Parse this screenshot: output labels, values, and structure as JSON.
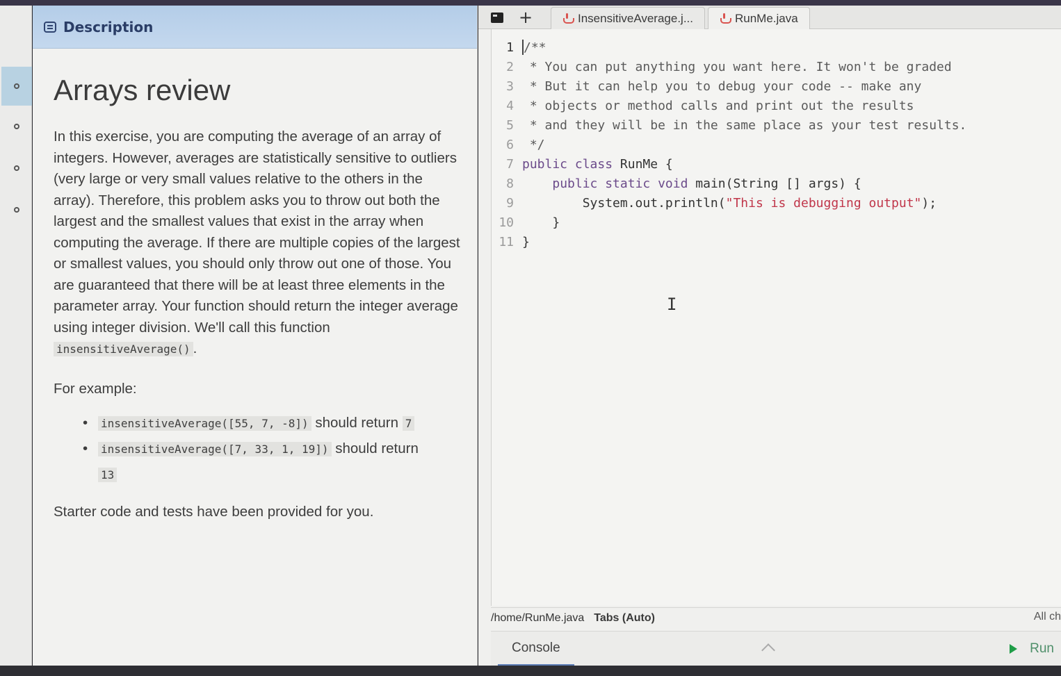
{
  "description_panel": {
    "header": "Description",
    "title": "Arrays review",
    "paragraph_parts": [
      "In this exercise, you are computing the average of an array of integers. However, averages are statistically sensitive to outliers (very large or very small values relative to the others in the array). Therefore, this problem asks you to throw out both the largest and the smallest values that exist in the array when computing the average. If there are multiple copies of the largest or smallest values, you should only throw out one of those. You are guaranteed that there will be at least three elements in the parameter array. Your function should return the integer average using integer division. We'll call this function ",
      "insensitiveAverage()",
      "."
    ],
    "for_example": "For example:",
    "examples": [
      {
        "code": "insensitiveAverage([55, 7, -8])",
        "text": " should return ",
        "result": "7"
      },
      {
        "code": "insensitiveAverage([7, 33, 1, 19])",
        "text": " should return ",
        "result": "13"
      }
    ],
    "starter": "Starter code and tests have been provided for you."
  },
  "rail": {
    "items": [
      {
        "name": "rail-item-1",
        "active": true
      },
      {
        "name": "rail-item-2",
        "active": false
      },
      {
        "name": "rail-item-3",
        "active": false
      },
      {
        "name": "rail-item-4",
        "active": false
      }
    ]
  },
  "editor": {
    "tabs": [
      {
        "label": "InsensitiveAverage.j...",
        "icon": "java-icon",
        "active": false
      },
      {
        "label": "RunMe.java",
        "icon": "java-icon",
        "active": true
      }
    ],
    "lines": [
      {
        "n": "1",
        "parts": [
          {
            "c": "cm",
            "t": "/**"
          }
        ]
      },
      {
        "n": "2",
        "parts": [
          {
            "c": "cm",
            "t": " * You can put anything you want here. It won't be graded"
          }
        ]
      },
      {
        "n": "3",
        "parts": [
          {
            "c": "cm",
            "t": " * But it can help you to debug your code -- make any"
          }
        ]
      },
      {
        "n": "4",
        "parts": [
          {
            "c": "cm",
            "t": " * objects or method calls and print out the results"
          }
        ]
      },
      {
        "n": "5",
        "parts": [
          {
            "c": "cm",
            "t": " * and they will be in the same place as your test results."
          }
        ]
      },
      {
        "n": "6",
        "parts": [
          {
            "c": "cm",
            "t": " */"
          }
        ]
      },
      {
        "n": "7",
        "parts": [
          {
            "c": "kw",
            "t": "public class "
          },
          {
            "c": "tx",
            "t": "RunMe {"
          }
        ]
      },
      {
        "n": "8",
        "parts": [
          {
            "c": "tx",
            "t": "    "
          },
          {
            "c": "kw",
            "t": "public static void "
          },
          {
            "c": "tx",
            "t": "main(String [] args) {"
          }
        ]
      },
      {
        "n": "9",
        "parts": [
          {
            "c": "tx",
            "t": "        System.out.println("
          },
          {
            "c": "str",
            "t": "\"This is debugging output\""
          },
          {
            "c": "tx",
            "t": ");"
          }
        ]
      },
      {
        "n": "10",
        "parts": [
          {
            "c": "tx",
            "t": "    }"
          }
        ]
      },
      {
        "n": "11",
        "parts": [
          {
            "c": "tx",
            "t": "}"
          }
        ]
      }
    ],
    "status_path": "/home/RunMe.java",
    "status_tabs": "Tabs (Auto)",
    "status_right": "All ch",
    "console_label": "Console",
    "run_label": "Run"
  }
}
